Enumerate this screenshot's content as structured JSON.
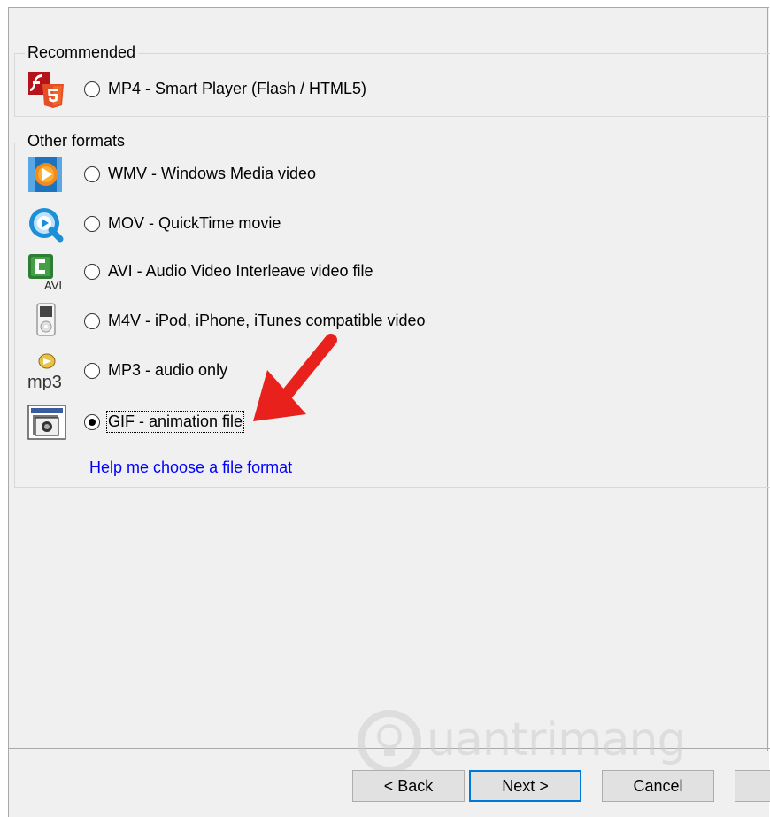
{
  "recommended": {
    "title": "Recommended",
    "option": {
      "label": "MP4 - Smart Player (Flash / HTML5)",
      "icon": "flash-html5-icon",
      "selected": false
    }
  },
  "other_formats": {
    "title": "Other formats",
    "options": [
      {
        "label": "WMV - Windows Media video",
        "icon": "windows-media-icon",
        "selected": false
      },
      {
        "label": "MOV - QuickTime movie",
        "icon": "quicktime-icon",
        "selected": false
      },
      {
        "label": "AVI - Audio Video Interleave video file",
        "icon": "avi-icon",
        "selected": false
      },
      {
        "label": "M4V - iPod, iPhone, iTunes compatible video",
        "icon": "ipod-icon",
        "selected": false
      },
      {
        "label": "MP3 - audio only",
        "icon": "mp3-icon",
        "selected": false
      },
      {
        "label": "GIF - animation file",
        "icon": "gif-icon",
        "selected": true
      }
    ]
  },
  "help_link": "Help me choose a file format",
  "icon_text": {
    "avi": "AVI",
    "mp3": "mp3"
  },
  "buttons": {
    "back": "< Back",
    "next": "Next >",
    "cancel": "Cancel"
  },
  "watermark": {
    "text": "uantrimang"
  },
  "colors": {
    "link": "#0000ff",
    "arrow": "#e8211c",
    "default_button_border": "#0078d7"
  }
}
